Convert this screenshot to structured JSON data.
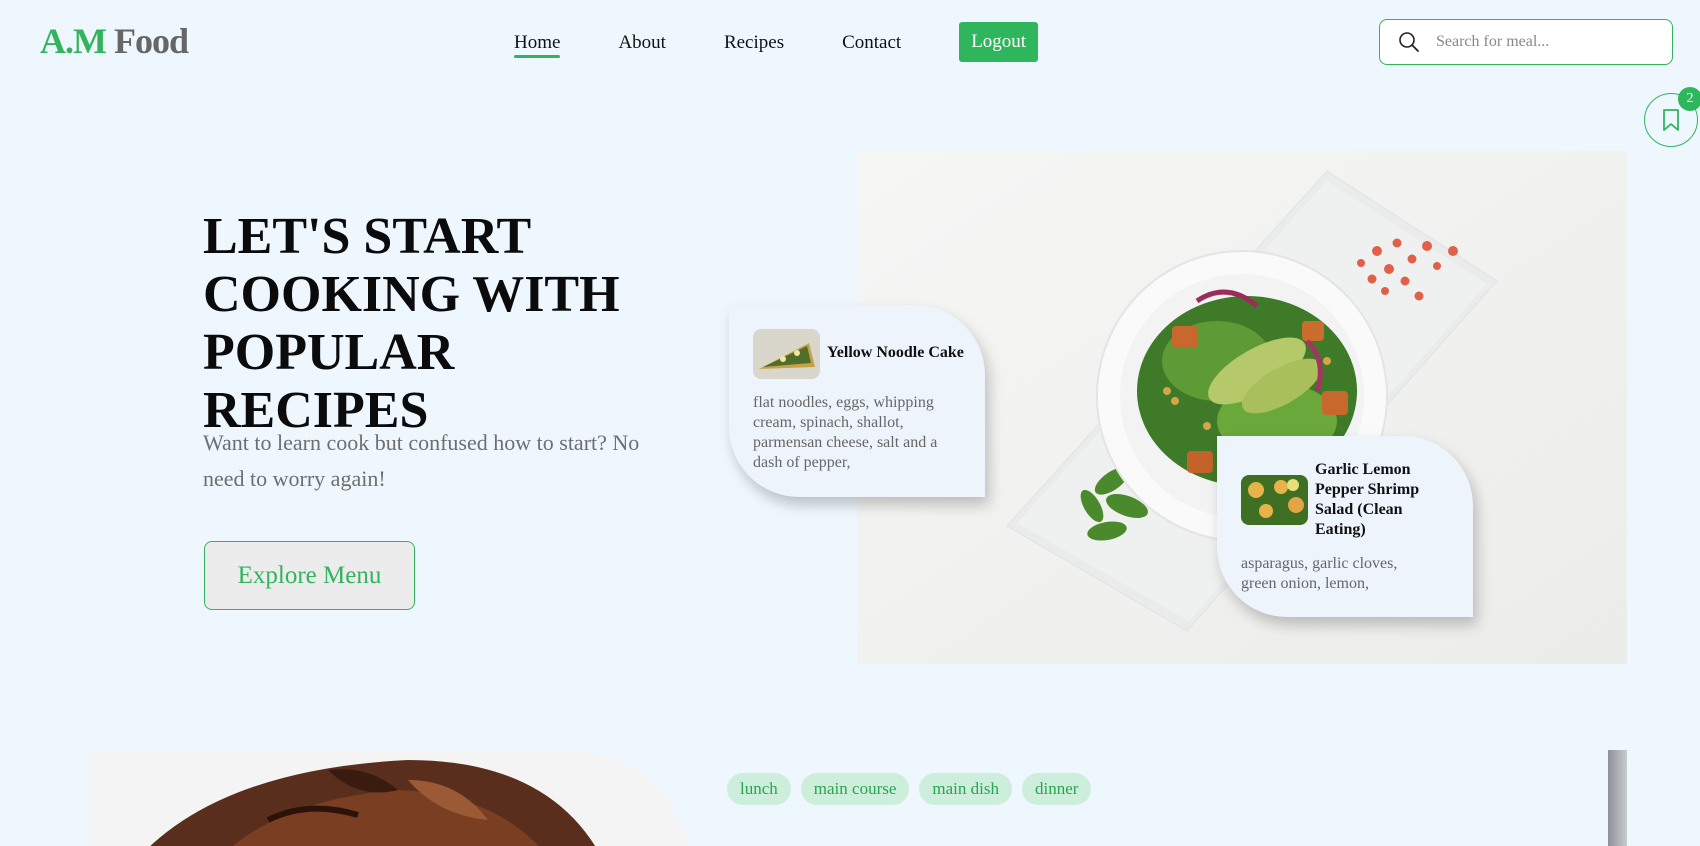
{
  "logo": {
    "part1": "A.M",
    "part2": "Food"
  },
  "nav": {
    "items": [
      {
        "label": "Home",
        "active": true
      },
      {
        "label": "About"
      },
      {
        "label": "Recipes"
      },
      {
        "label": "Contact"
      }
    ],
    "logout_label": "Logout"
  },
  "search": {
    "placeholder": "Search for meal...",
    "icon": "search-icon"
  },
  "bookmarks": {
    "icon": "bookmark-icon",
    "count": "2"
  },
  "hero": {
    "title": "LET'S START COOKING WITH POPULAR RECIPES",
    "subtitle": "Want to learn cook but confused how to start? No need to worry again!",
    "button_label": "Explore Menu"
  },
  "cards": [
    {
      "title": "Yellow Noodle Cake",
      "ingredients": "flat noodles, eggs, whipping cream, spinach, shallot, parmensan cheese, salt and a dash of pepper,"
    },
    {
      "title": "Garlic Lemon Pepper Shrimp Salad (Clean Eating)",
      "ingredients": "asparagus, garlic cloves, green onion, lemon,"
    }
  ],
  "tags": [
    "lunch",
    "main course",
    "main dish",
    "dinner"
  ],
  "colors": {
    "accent": "#34b35f",
    "background": "#eef7fe"
  }
}
